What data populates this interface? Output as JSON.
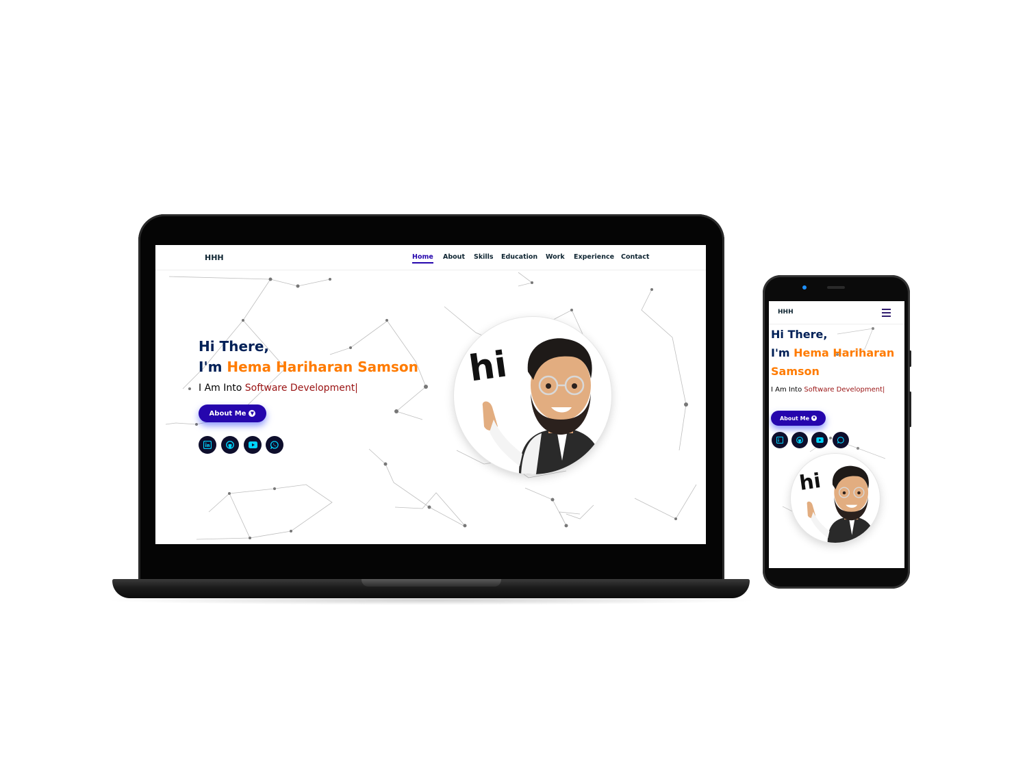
{
  "site": {
    "brand": "HHH",
    "nav": [
      {
        "label": "Home",
        "active": true
      },
      {
        "label": "About"
      },
      {
        "label": "Skills"
      },
      {
        "label": "Education"
      },
      {
        "label": "Work"
      },
      {
        "label": "Experience"
      },
      {
        "label": "Contact"
      }
    ],
    "hero": {
      "greeting": "Hi There,",
      "im": "I'm ",
      "name": "Hema Hariharan Samson",
      "name_line1": "Hema Hariharan",
      "name_line2": "Samson",
      "into_prefix": "I Am Into ",
      "role": "Software Development|",
      "button": "About Me"
    },
    "social_icons": [
      "linkedin-icon",
      "github-icon",
      "youtube-icon",
      "whatsapp-icon"
    ],
    "avatar_text": "hi"
  },
  "colors": {
    "heading": "#002057",
    "name": "#ff7b00",
    "role": "#991111",
    "button": "#2506ad",
    "social_bg": "#0e0e2c",
    "social_icon": "#00d4ff"
  }
}
